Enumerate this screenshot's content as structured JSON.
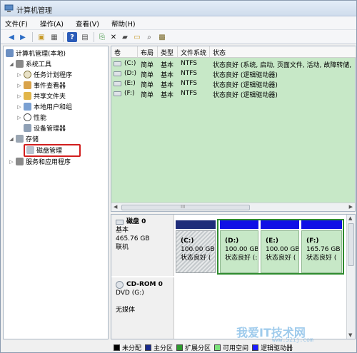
{
  "window": {
    "title": "计算机管理"
  },
  "menu": [
    "文件(F)",
    "操作(A)",
    "查看(V)",
    "帮助(H)"
  ],
  "toolbar": [
    "back-icon",
    "forward-icon",
    "up-folder-icon",
    "grid-icon",
    "help-icon",
    "show-hide-icon",
    "new-icon",
    "delete-icon",
    "properties-icon",
    "open-icon",
    "search-icon",
    "disk-icon"
  ],
  "tree": {
    "root": "计算机管理(本地)",
    "system_tools": "系统工具",
    "task_scheduler": "任务计划程序",
    "event_viewer": "事件查看器",
    "shared_folders": "共享文件夹",
    "local_users": "本地用户和组",
    "performance": "性能",
    "device_manager": "设备管理器",
    "storage": "存储",
    "disk_management": "磁盘管理",
    "services_apps": "服务和应用程序"
  },
  "volume_table": {
    "headers": [
      "卷",
      "布局",
      "类型",
      "文件系统",
      "状态"
    ],
    "rows": [
      {
        "vol": "(C:)",
        "layout": "简单",
        "type": "基本",
        "fs": "NTFS",
        "status": "状态良好 (系统, 启动, 页面文件, 活动, 故障转储,"
      },
      {
        "vol": "(D:)",
        "layout": "简单",
        "type": "基本",
        "fs": "NTFS",
        "status": "状态良好 (逻辑驱动器)"
      },
      {
        "vol": "(E:)",
        "layout": "简单",
        "type": "基本",
        "fs": "NTFS",
        "status": "状态良好 (逻辑驱动器)"
      },
      {
        "vol": "(F:)",
        "layout": "简单",
        "type": "基本",
        "fs": "NTFS",
        "status": "状态良好 (逻辑驱动器)"
      }
    ],
    "scroll_marker": "III"
  },
  "disk0": {
    "name": "磁盘 0",
    "type": "基本",
    "size": "465.76 GB",
    "status": "联机",
    "partitions": [
      {
        "label": "(C:)",
        "size": "100.00 GB",
        "status": "状态良好 ("
      },
      {
        "label": "(D:)",
        "size": "100.00 GB",
        "status": "状态良好 (:"
      },
      {
        "label": "(E:)",
        "size": "100.00 GB",
        "status": "状态良好 ("
      },
      {
        "label": "(F:)",
        "size": "165.76 GB",
        "status": "状态良好 ("
      }
    ]
  },
  "cdrom": {
    "name": "CD-ROM 0",
    "drive": "DVD (G:)",
    "media": "无媒体"
  },
  "legend": [
    {
      "label": "未分配",
      "color": "#000000"
    },
    {
      "label": "主分区",
      "color": "#1a2b8c"
    },
    {
      "label": "扩展分区",
      "color": "#2e9a2e"
    },
    {
      "label": "可用空间",
      "color": "#7be27b"
    },
    {
      "label": "逻辑驱动器",
      "color": "#1a1aff"
    }
  ],
  "watermark": {
    "main": "我爱IT技术网",
    "sub": "www.52ij.com"
  },
  "colors": {
    "primary_bar": "#1f2d7a",
    "logical_bar": "#1010e6",
    "extended_border": "#2e8b2e",
    "table_bg": "#c7e8c7",
    "highlight": "#d21e1e"
  }
}
